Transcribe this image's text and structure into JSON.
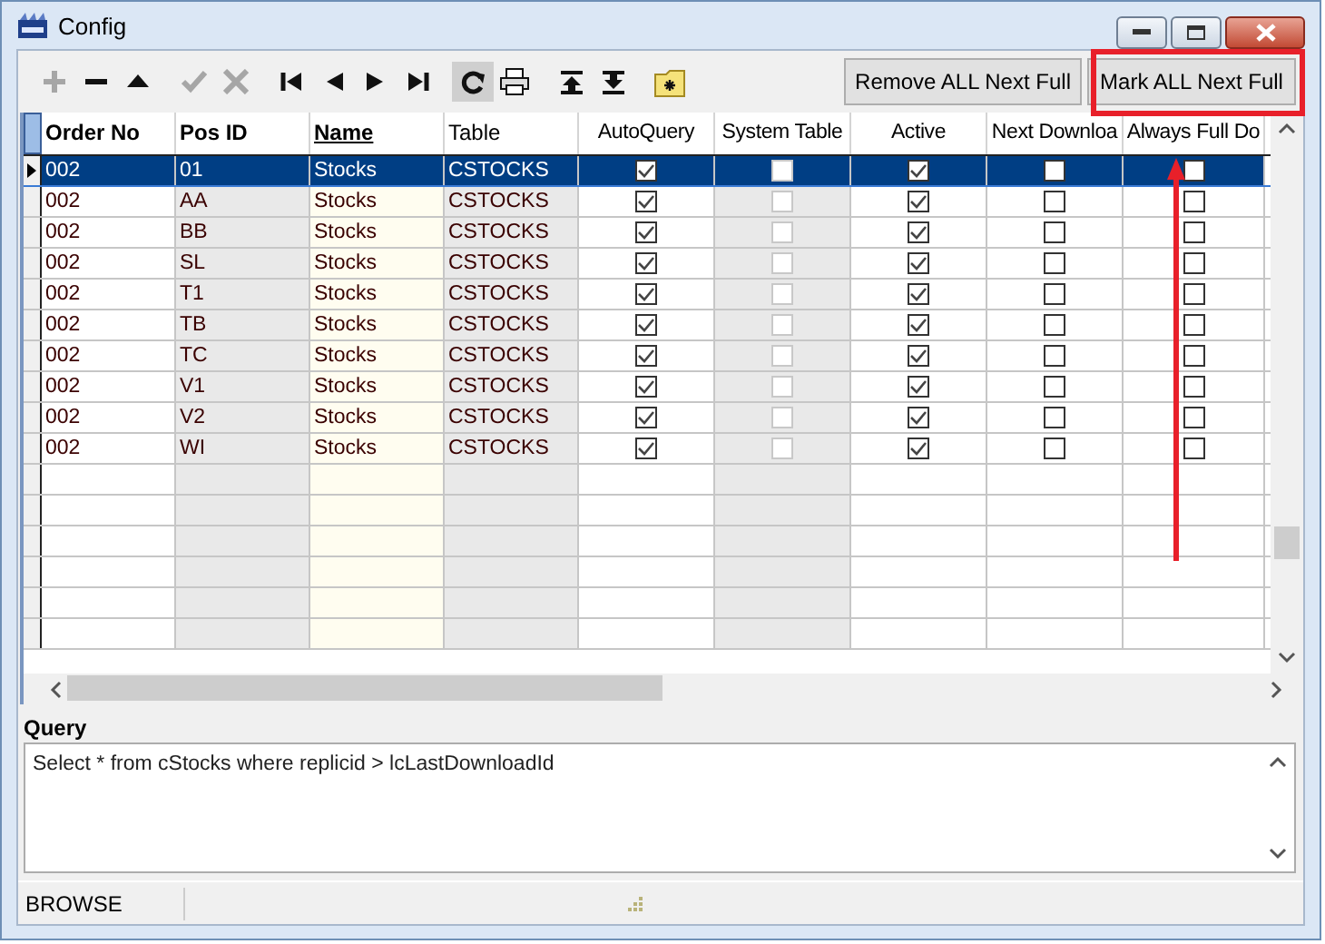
{
  "window": {
    "title": "Config"
  },
  "toolbar": [
    {
      "kind": "plus",
      "disabled": true
    },
    {
      "kind": "minus",
      "disabled": false
    },
    {
      "kind": "up",
      "disabled": false
    },
    {
      "kind": "check",
      "disabled": true
    },
    {
      "kind": "cross",
      "disabled": true
    },
    {
      "kind": "first",
      "disabled": false
    },
    {
      "kind": "prev",
      "disabled": false
    },
    {
      "kind": "next",
      "disabled": false
    },
    {
      "kind": "last",
      "disabled": false
    },
    {
      "kind": "refresh",
      "disabled": false,
      "pressed": true
    },
    {
      "kind": "print",
      "disabled": false
    },
    {
      "kind": "top",
      "disabled": false
    },
    {
      "kind": "bottom",
      "disabled": false
    },
    {
      "kind": "folder",
      "disabled": false
    }
  ],
  "buttons": [
    {
      "label": "Remove ALL Next Full",
      "highlighted": false
    },
    {
      "label": "Mark ALL Next Full",
      "highlighted": true
    }
  ],
  "table": {
    "columns": [
      {
        "label": "Order No",
        "kind": "text",
        "bold": true,
        "sorted": false
      },
      {
        "label": "Pos ID",
        "kind": "text",
        "bold": true,
        "sorted": false
      },
      {
        "label": "Name",
        "kind": "text",
        "bold": true,
        "sorted": true
      },
      {
        "label": "Table",
        "kind": "text",
        "bold": false,
        "sorted": false
      },
      {
        "label": "AutoQuery",
        "kind": "check",
        "bold": false,
        "sorted": false
      },
      {
        "label": "System Table",
        "kind": "check",
        "bold": false,
        "sorted": false
      },
      {
        "label": "Active",
        "kind": "check",
        "bold": false,
        "sorted": false
      },
      {
        "label": "Next Downloa",
        "kind": "check",
        "bold": false,
        "sorted": false
      },
      {
        "label": "Always Full Do",
        "kind": "check",
        "bold": false,
        "sorted": false
      }
    ],
    "rows": [
      {
        "selected": true,
        "cells": [
          "002",
          "01",
          "Stocks",
          "CSTOCKS",
          {
            "checked": true,
            "disabled": false
          },
          {
            "checked": false,
            "disabled": true
          },
          {
            "checked": true,
            "disabled": false
          },
          {
            "checked": false,
            "disabled": false
          },
          {
            "checked": false,
            "disabled": false
          }
        ]
      },
      {
        "selected": false,
        "cells": [
          "002",
          "AA",
          "Stocks",
          "CSTOCKS",
          {
            "checked": true,
            "disabled": false
          },
          {
            "checked": false,
            "disabled": true
          },
          {
            "checked": true,
            "disabled": false
          },
          {
            "checked": false,
            "disabled": false
          },
          {
            "checked": false,
            "disabled": false
          }
        ]
      },
      {
        "selected": false,
        "cells": [
          "002",
          "BB",
          "Stocks",
          "CSTOCKS",
          {
            "checked": true,
            "disabled": false
          },
          {
            "checked": false,
            "disabled": true
          },
          {
            "checked": true,
            "disabled": false
          },
          {
            "checked": false,
            "disabled": false
          },
          {
            "checked": false,
            "disabled": false
          }
        ]
      },
      {
        "selected": false,
        "cells": [
          "002",
          "SL",
          "Stocks",
          "CSTOCKS",
          {
            "checked": true,
            "disabled": false
          },
          {
            "checked": false,
            "disabled": true
          },
          {
            "checked": true,
            "disabled": false
          },
          {
            "checked": false,
            "disabled": false
          },
          {
            "checked": false,
            "disabled": false
          }
        ]
      },
      {
        "selected": false,
        "cells": [
          "002",
          "T1",
          "Stocks",
          "CSTOCKS",
          {
            "checked": true,
            "disabled": false
          },
          {
            "checked": false,
            "disabled": true
          },
          {
            "checked": true,
            "disabled": false
          },
          {
            "checked": false,
            "disabled": false
          },
          {
            "checked": false,
            "disabled": false
          }
        ]
      },
      {
        "selected": false,
        "cells": [
          "002",
          "TB",
          "Stocks",
          "CSTOCKS",
          {
            "checked": true,
            "disabled": false
          },
          {
            "checked": false,
            "disabled": true
          },
          {
            "checked": true,
            "disabled": false
          },
          {
            "checked": false,
            "disabled": false
          },
          {
            "checked": false,
            "disabled": false
          }
        ]
      },
      {
        "selected": false,
        "cells": [
          "002",
          "TC",
          "Stocks",
          "CSTOCKS",
          {
            "checked": true,
            "disabled": false
          },
          {
            "checked": false,
            "disabled": true
          },
          {
            "checked": true,
            "disabled": false
          },
          {
            "checked": false,
            "disabled": false
          },
          {
            "checked": false,
            "disabled": false
          }
        ]
      },
      {
        "selected": false,
        "cells": [
          "002",
          "V1",
          "Stocks",
          "CSTOCKS",
          {
            "checked": true,
            "disabled": false
          },
          {
            "checked": false,
            "disabled": true
          },
          {
            "checked": true,
            "disabled": false
          },
          {
            "checked": false,
            "disabled": false
          },
          {
            "checked": false,
            "disabled": false
          }
        ]
      },
      {
        "selected": false,
        "cells": [
          "002",
          "V2",
          "Stocks",
          "CSTOCKS",
          {
            "checked": true,
            "disabled": false
          },
          {
            "checked": false,
            "disabled": true
          },
          {
            "checked": true,
            "disabled": false
          },
          {
            "checked": false,
            "disabled": false
          },
          {
            "checked": false,
            "disabled": false
          }
        ]
      },
      {
        "selected": false,
        "cells": [
          "002",
          "WI",
          "Stocks",
          "CSTOCKS",
          {
            "checked": true,
            "disabled": false
          },
          {
            "checked": false,
            "disabled": true
          },
          {
            "checked": true,
            "disabled": false
          },
          {
            "checked": false,
            "disabled": false
          },
          {
            "checked": false,
            "disabled": false
          }
        ]
      }
    ]
  },
  "query": {
    "label": "Query",
    "value": "Select * from cStocks  where replicid > lcLastDownloadId"
  },
  "status_bar": {
    "mode": "BROWSE"
  }
}
